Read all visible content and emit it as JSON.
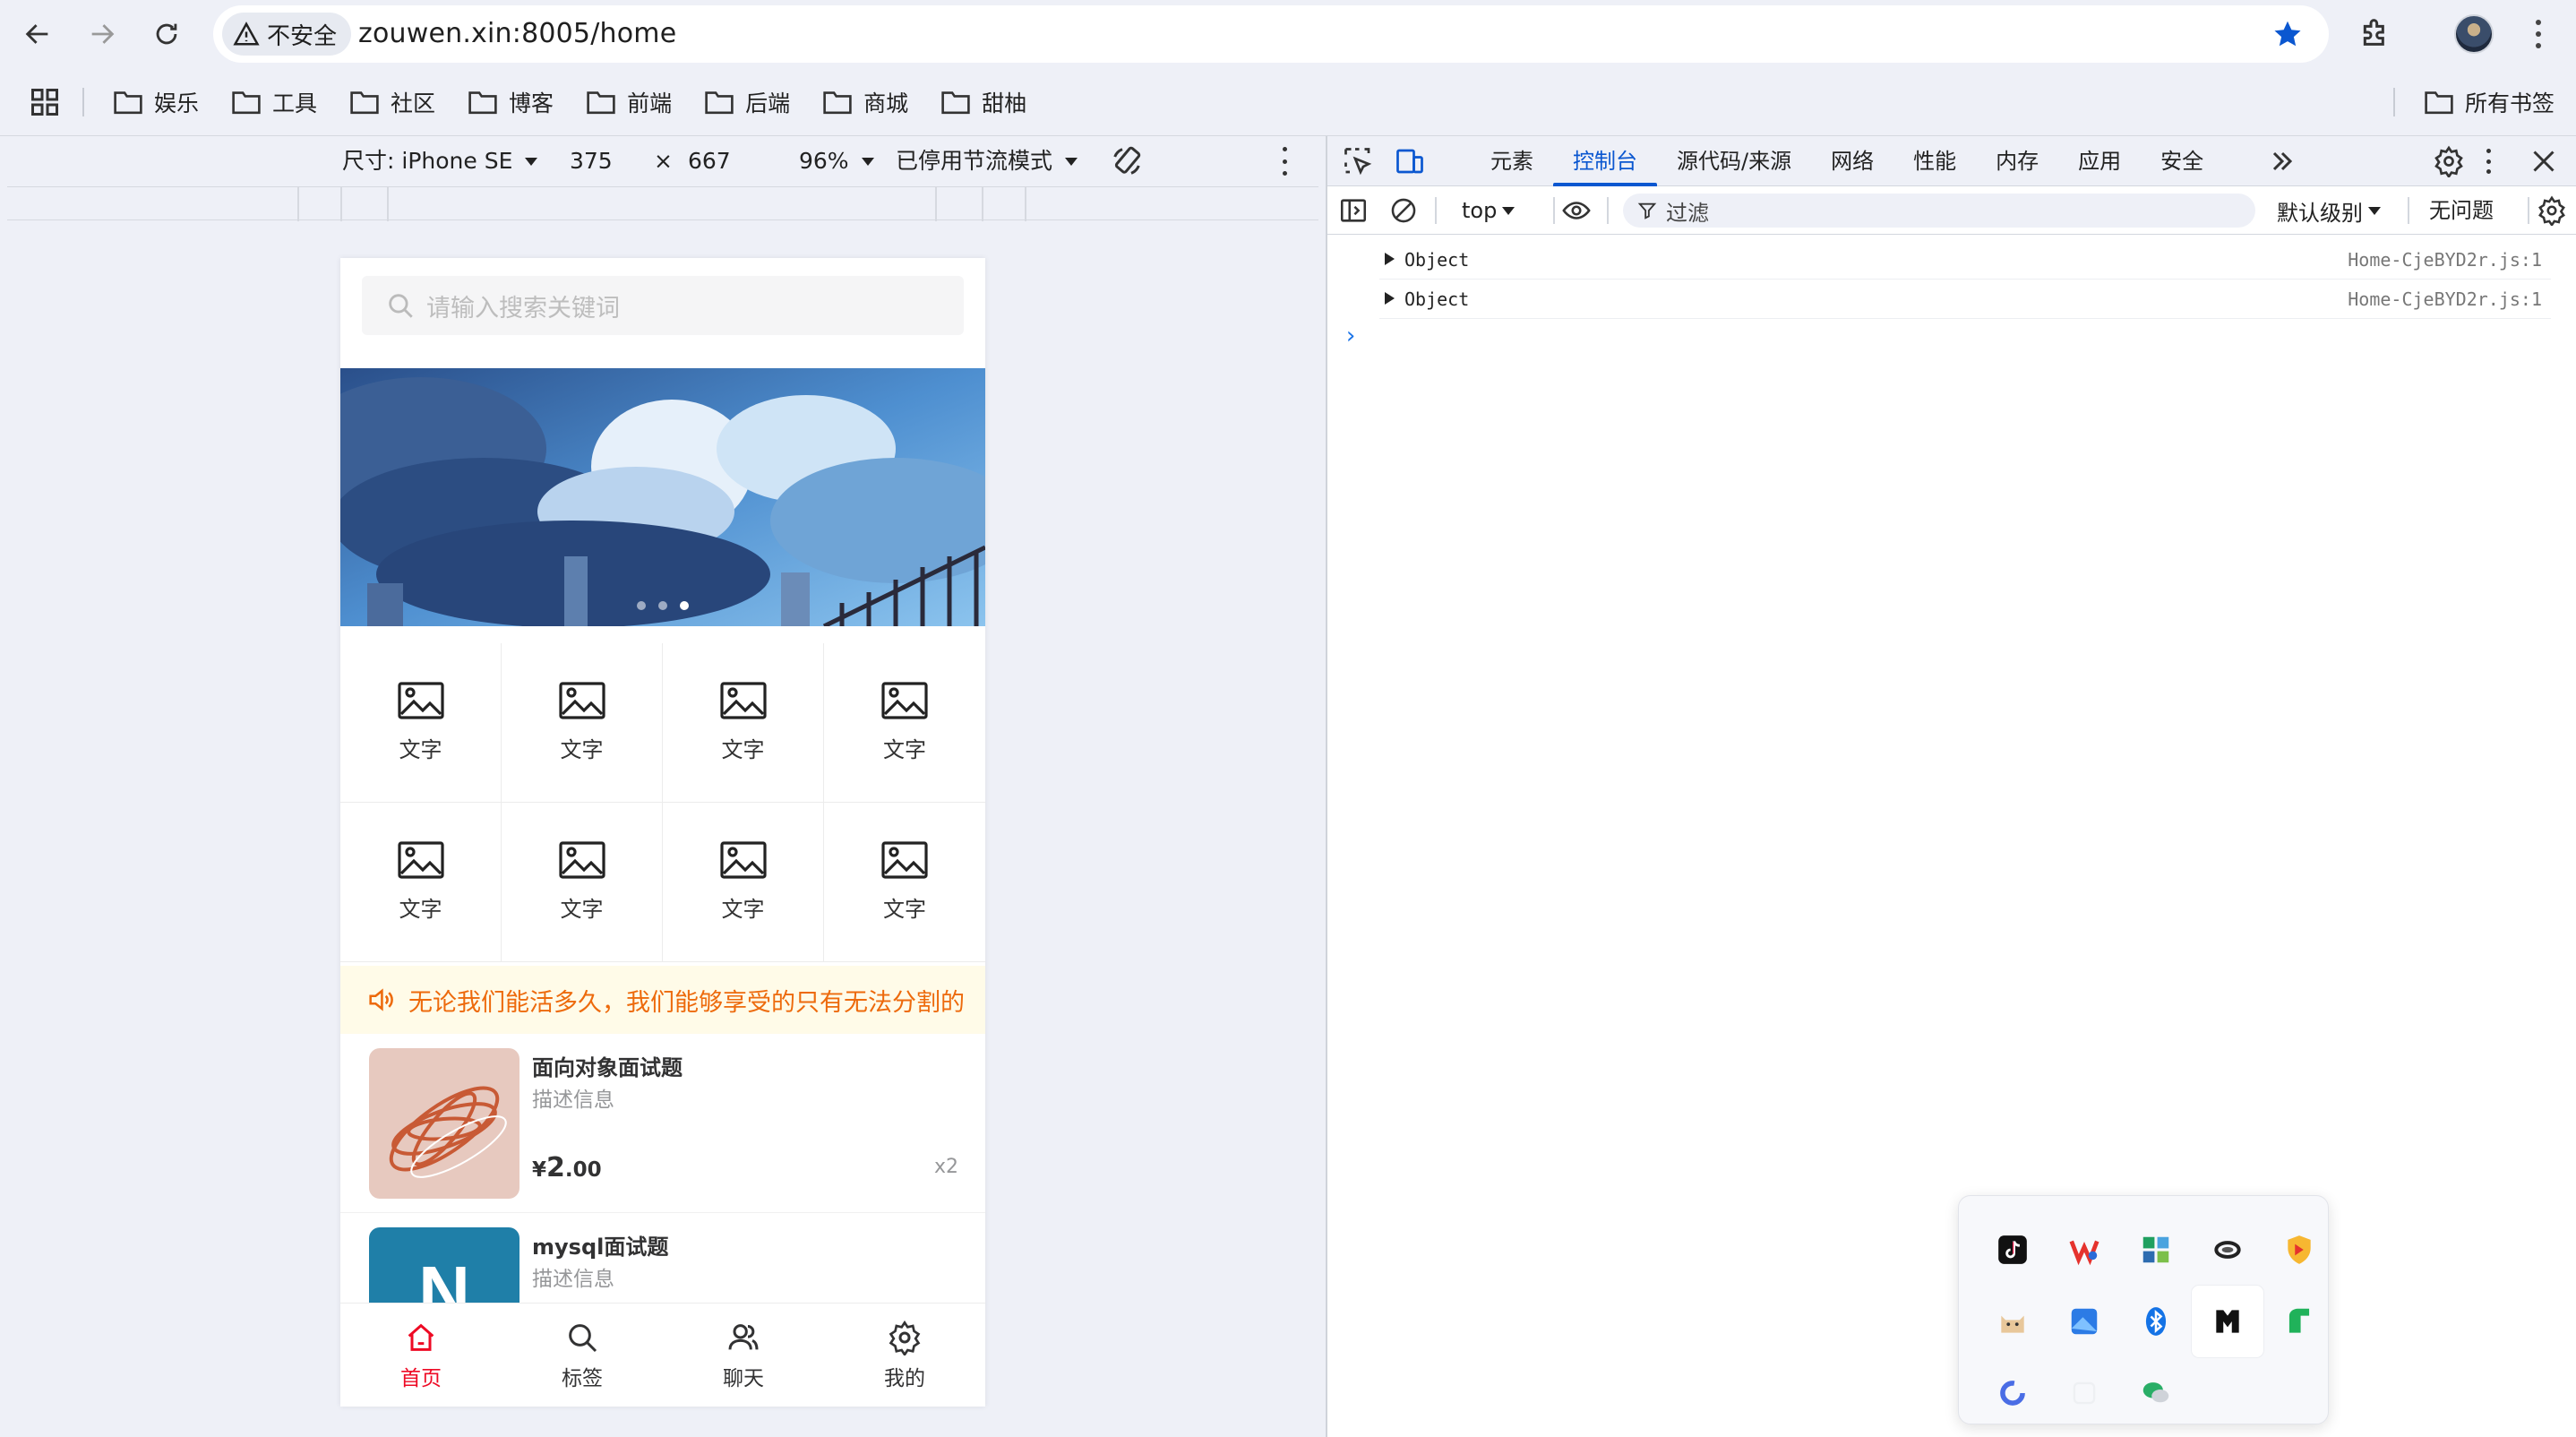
{
  "browser": {
    "security_label": "不安全",
    "url": "zouwen.xin:8005/home",
    "bookmarks": [
      "娱乐",
      "工具",
      "社区",
      "博客",
      "前端",
      "后端",
      "商城",
      "甜柚"
    ],
    "all_bookmarks": "所有书签"
  },
  "device_toolbar": {
    "size_label": "尺寸: iPhone SE",
    "width": "375",
    "times": "×",
    "height": "667",
    "zoom": "96%",
    "throttle": "已停用节流模式"
  },
  "phone": {
    "search_placeholder": "请输入搜索关键词",
    "banner_slides": 3,
    "banner_active_index": 2,
    "grid_items": [
      "文字",
      "文字",
      "文字",
      "文字",
      "文字",
      "文字",
      "文字",
      "文字"
    ],
    "notice": "无论我们能活多久，我们能够享受的只有无法分割的",
    "products": [
      {
        "title": "面向对象面试题",
        "desc": "描述信息",
        "currency": "¥",
        "price_int": "2",
        "price_dec": ".00",
        "num": "x2"
      },
      {
        "title": "mysql面试题",
        "desc": "描述信息",
        "thumb_letter": "N"
      }
    ],
    "tabbar": [
      {
        "label": "首页",
        "icon": "home-icon",
        "active": true
      },
      {
        "label": "标签",
        "icon": "search-icon",
        "active": false
      },
      {
        "label": "聊天",
        "icon": "friends-icon",
        "active": false
      },
      {
        "label": "我的",
        "icon": "setting-icon",
        "active": false
      }
    ],
    "accent_color": "#ee0a24",
    "notice_color": "#ed6a0c"
  },
  "devtools": {
    "tabs": [
      "元素",
      "控制台",
      "源代码/来源",
      "网络",
      "性能",
      "内存",
      "应用",
      "安全"
    ],
    "active_tab": "控制台",
    "context": "top",
    "filter_placeholder": "过滤",
    "level": "默认级别",
    "issues": "无问题",
    "logs": [
      {
        "text": "Object",
        "source": "Home-CjeBYD2r.js:1"
      },
      {
        "text": "Object",
        "source": "Home-CjeBYD2r.js:1"
      }
    ],
    "prompt": "›",
    "accent_color": "#0b57d0"
  },
  "tray": {
    "icons": [
      "tiktok-icon",
      "wps-icon",
      "app-grid-icon",
      "cloud-icon",
      "shield-icon",
      "cat-icon",
      "screenshot-icon",
      "bluetooth-icon",
      "notion-icon",
      "green-app-icon",
      "ring-icon",
      "blank-icon",
      "wechat-icon"
    ]
  }
}
